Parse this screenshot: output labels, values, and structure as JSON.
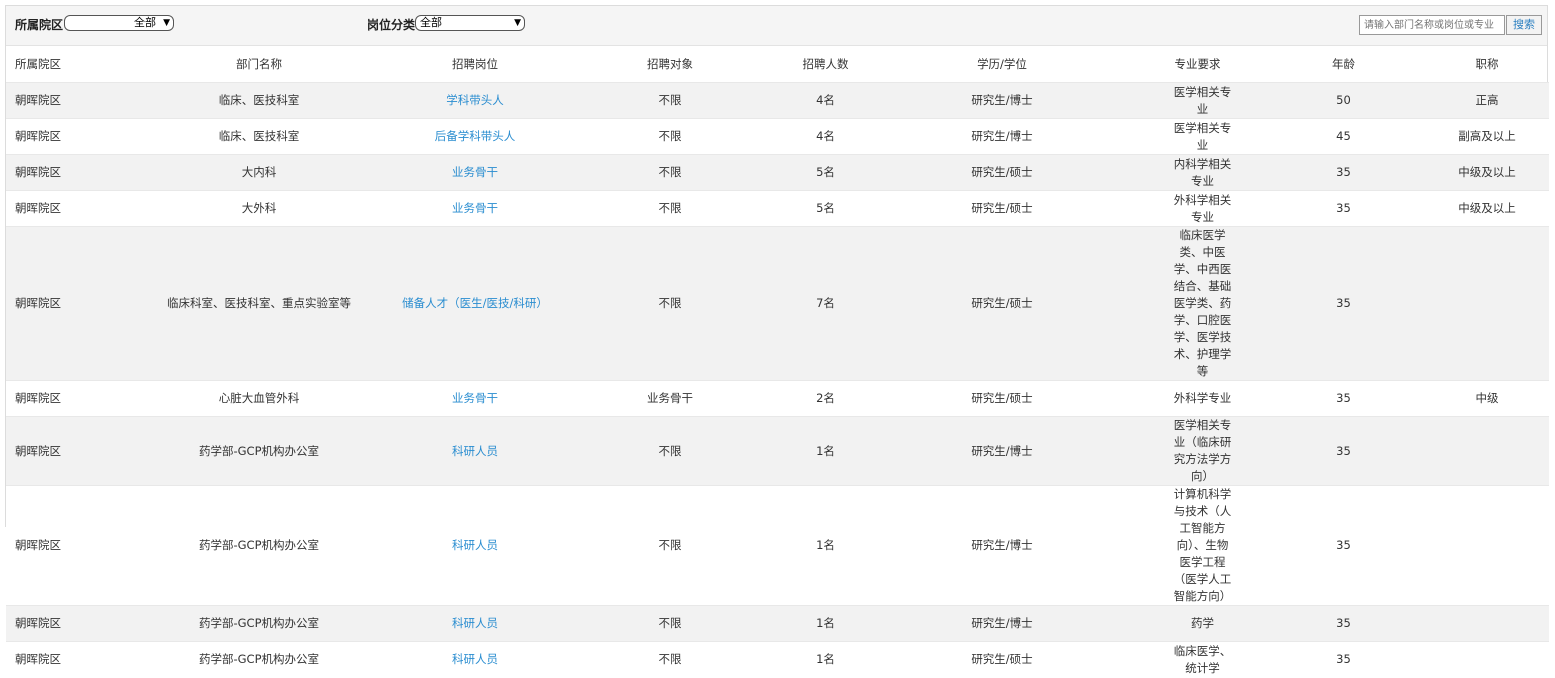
{
  "filters": {
    "district_label": "所属院区",
    "district_value": "全部",
    "category_label": "岗位分类",
    "category_value": "全部",
    "search_placeholder": "请输入部门名称或岗位或专业",
    "search_button": "搜索"
  },
  "table": {
    "headers": [
      "所属院区",
      "部门名称",
      "招聘岗位",
      "招聘对象",
      "招聘人数",
      "学历/学位",
      "专业要求",
      "年龄",
      "职称"
    ],
    "rows": [
      {
        "district": "朝晖院区",
        "dept": "临床、医技科室",
        "position": "学科带头人",
        "target": "不限",
        "count": "4名",
        "degree": "研究生/博士",
        "major": "医学相关专业",
        "age": "50",
        "title": "正高"
      },
      {
        "district": "朝晖院区",
        "dept": "临床、医技科室",
        "position": "后备学科带头人",
        "target": "不限",
        "count": "4名",
        "degree": "研究生/博士",
        "major": "医学相关专业",
        "age": "45",
        "title": "副高及以上"
      },
      {
        "district": "朝晖院区",
        "dept": "大内科",
        "position": "业务骨干",
        "target": "不限",
        "count": "5名",
        "degree": "研究生/硕士",
        "major": "内科学相关专业",
        "age": "35",
        "title": "中级及以上"
      },
      {
        "district": "朝晖院区",
        "dept": "大外科",
        "position": "业务骨干",
        "target": "不限",
        "count": "5名",
        "degree": "研究生/硕士",
        "major": "外科学相关专业",
        "age": "35",
        "title": "中级及以上"
      },
      {
        "district": "朝晖院区",
        "dept": "临床科室、医技科室、重点实验室等",
        "position": "储备人才（医生/医技/科研）",
        "target": "不限",
        "count": "7名",
        "degree": "研究生/硕士",
        "major": "临床医学类、中医学、中西医结合、基础医学类、药学、口腔医学、医学技术、护理学等",
        "age": "35",
        "title": ""
      },
      {
        "district": "朝晖院区",
        "dept": "心脏大血管外科",
        "position": "业务骨干",
        "target": "业务骨干",
        "count": "2名",
        "degree": "研究生/硕士",
        "major": "外科学专业",
        "age": "35",
        "title": "中级"
      },
      {
        "district": "朝晖院区",
        "dept": "药学部-GCP机构办公室",
        "position": "科研人员",
        "target": "不限",
        "count": "1名",
        "degree": "研究生/博士",
        "major": "医学相关专业（临床研究方法学方向）",
        "age": "35",
        "title": ""
      },
      {
        "district": "朝晖院区",
        "dept": "药学部-GCP机构办公室",
        "position": "科研人员",
        "target": "不限",
        "count": "1名",
        "degree": "研究生/博士",
        "major": "计算机科学与技术（人工智能方向）、生物医学工程（医学人工智能方向）",
        "age": "35",
        "title": ""
      },
      {
        "district": "朝晖院区",
        "dept": "药学部-GCP机构办公室",
        "position": "科研人员",
        "target": "不限",
        "count": "1名",
        "degree": "研究生/博士",
        "major": "药学",
        "age": "35",
        "title": ""
      },
      {
        "district": "朝晖院区",
        "dept": "药学部-GCP机构办公室",
        "position": "科研人员",
        "target": "不限",
        "count": "1名",
        "degree": "研究生/硕士",
        "major": "临床医学、统计学",
        "age": "35",
        "title": ""
      }
    ]
  }
}
